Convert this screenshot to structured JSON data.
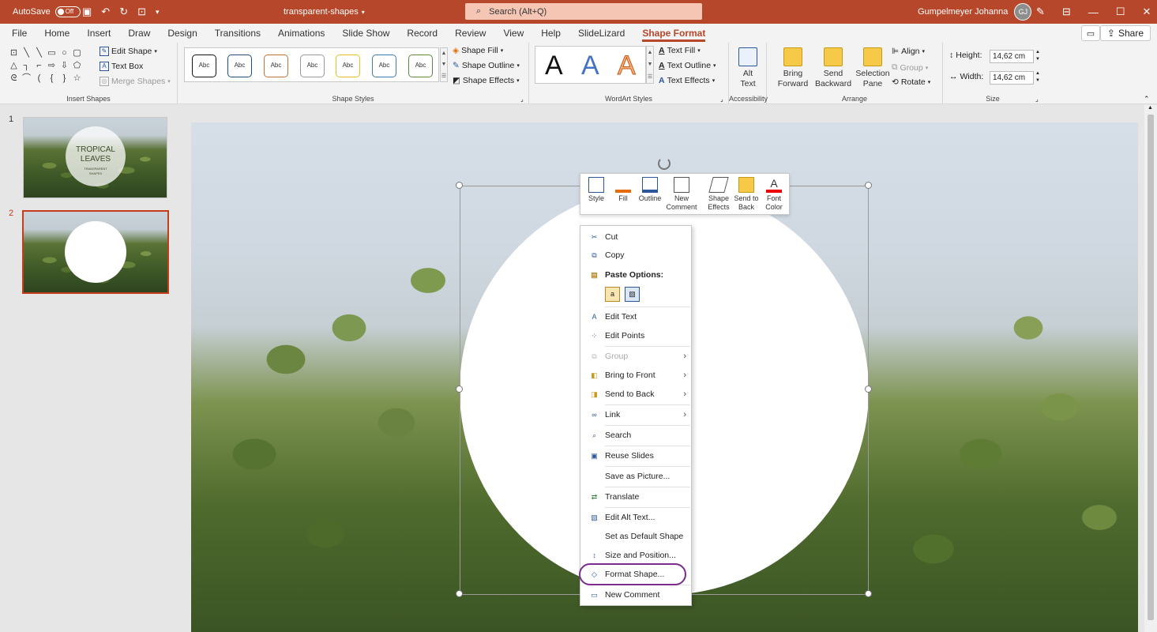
{
  "titlebar": {
    "autosave_label": "AutoSave",
    "autosave_state": "Off",
    "doc_title": "transparent-shapes",
    "search_placeholder": "Search (Alt+Q)",
    "user_name": "Gumpelmeyer Johanna",
    "user_initials": "GJ"
  },
  "tabs": [
    "File",
    "Home",
    "Insert",
    "Draw",
    "Design",
    "Transitions",
    "Animations",
    "Slide Show",
    "Record",
    "Review",
    "View",
    "Help",
    "SlideLizard",
    "Shape Format"
  ],
  "share_label": "Share",
  "ribbon": {
    "insert_shapes": {
      "edit_shape": "Edit Shape",
      "text_box": "Text Box",
      "merge_shapes": "Merge Shapes",
      "label": "Insert Shapes"
    },
    "shape_styles": {
      "swatch_text": "Abc",
      "shape_fill": "Shape Fill",
      "shape_outline": "Shape Outline",
      "shape_effects": "Shape Effects",
      "label": "Shape Styles"
    },
    "wordart": {
      "letter": "A",
      "text_fill": "Text Fill",
      "text_outline": "Text Outline",
      "text_effects": "Text Effects",
      "label": "WordArt Styles"
    },
    "accessibility": {
      "alt_text_1": "Alt",
      "alt_text_2": "Text",
      "label": "Accessibility"
    },
    "arrange": {
      "bring_forward_1": "Bring",
      "bring_forward_2": "Forward",
      "send_backward_1": "Send",
      "send_backward_2": "Backward",
      "selection_pane_1": "Selection",
      "selection_pane_2": "Pane",
      "align": "Align",
      "group": "Group",
      "rotate": "Rotate",
      "label": "Arrange"
    },
    "size": {
      "height_label": "Height:",
      "height_value": "14,62 cm",
      "width_label": "Width:",
      "width_value": "14,62 cm",
      "label": "Size"
    }
  },
  "slides": [
    {
      "number": "1",
      "title_line1": "TROPICAL",
      "title_line2": "LEAVES",
      "subtitle_line1": "TRANSPARENT",
      "subtitle_line2": "SHAPES"
    },
    {
      "number": "2"
    }
  ],
  "minibar": {
    "style": "Style",
    "fill": "Fill",
    "outline": "Outline",
    "new_comment_1": "New",
    "new_comment_2": "Comment",
    "shape_effects_1": "Shape",
    "shape_effects_2": "Effects",
    "send_back_1": "Send to",
    "send_back_2": "Back",
    "font_color_1": "Font",
    "font_color_2": "Color"
  },
  "context_menu": {
    "cut": "Cut",
    "copy": "Copy",
    "paste_options": "Paste Options:",
    "edit_text": "Edit Text",
    "edit_points": "Edit Points",
    "group": "Group",
    "bring_to_front": "Bring to Front",
    "send_to_back": "Send to Back",
    "link": "Link",
    "search": "Search",
    "reuse_slides": "Reuse Slides",
    "save_as_picture": "Save as Picture...",
    "translate": "Translate",
    "edit_alt_text": "Edit Alt Text...",
    "set_default_shape": "Set as Default Shape",
    "size_and_position": "Size and Position...",
    "format_shape": "Format Shape...",
    "new_comment": "New Comment"
  },
  "colors": {
    "accent": "#b7472a",
    "highlight_ring": "#7a2d8c",
    "selected_thumb_border": "#c43e1c"
  }
}
